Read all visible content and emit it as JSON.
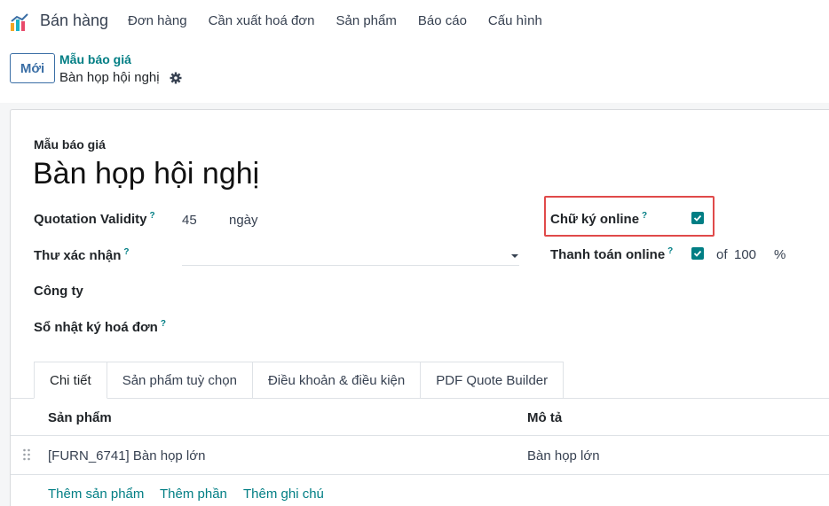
{
  "nav": {
    "app_name": "Bán hàng",
    "menu": [
      "Đơn hàng",
      "Cần xuất hoá đơn",
      "Sản phẩm",
      "Báo cáo",
      "Cấu hình"
    ]
  },
  "control": {
    "new_label": "Mới",
    "breadcrumb_parent": "Mẫu báo giá",
    "breadcrumb_current": "Bàn họp hội nghị"
  },
  "form": {
    "record_type": "Mẫu báo giá",
    "title": "Bàn họp hội nghị",
    "help_mark": "?",
    "fields": {
      "validity_label": "Quotation Validity",
      "validity_value": "45",
      "validity_unit": "ngày",
      "confirm_mail_label": "Thư xác nhận",
      "confirm_mail_value": "",
      "company_label": "Công ty",
      "journal_label": "Sổ nhật ký hoá đơn",
      "signature_label": "Chữ ký online",
      "signature_checked": true,
      "payment_label": "Thanh toán online",
      "payment_checked": true,
      "payment_of": "of",
      "payment_percent": "100",
      "payment_unit": "%"
    }
  },
  "tabs": [
    "Chi tiết",
    "Sản phẩm tuỳ chọn",
    "Điều khoản & điều kiện",
    "PDF Quote Builder"
  ],
  "active_tab": "Chi tiết",
  "table": {
    "headers": [
      "Sản phẩm",
      "Mô tả"
    ],
    "rows": [
      {
        "product": "[FURN_6741] Bàn họp lớn",
        "description": "Bàn họp lớn"
      }
    ]
  },
  "footer_links": [
    "Thêm sản phẩm",
    "Thêm phần",
    "Thêm ghi chú"
  ],
  "colors": {
    "accent": "#017e84",
    "highlight_box": "#e04a4a",
    "new_button": "#3a6ea5"
  }
}
